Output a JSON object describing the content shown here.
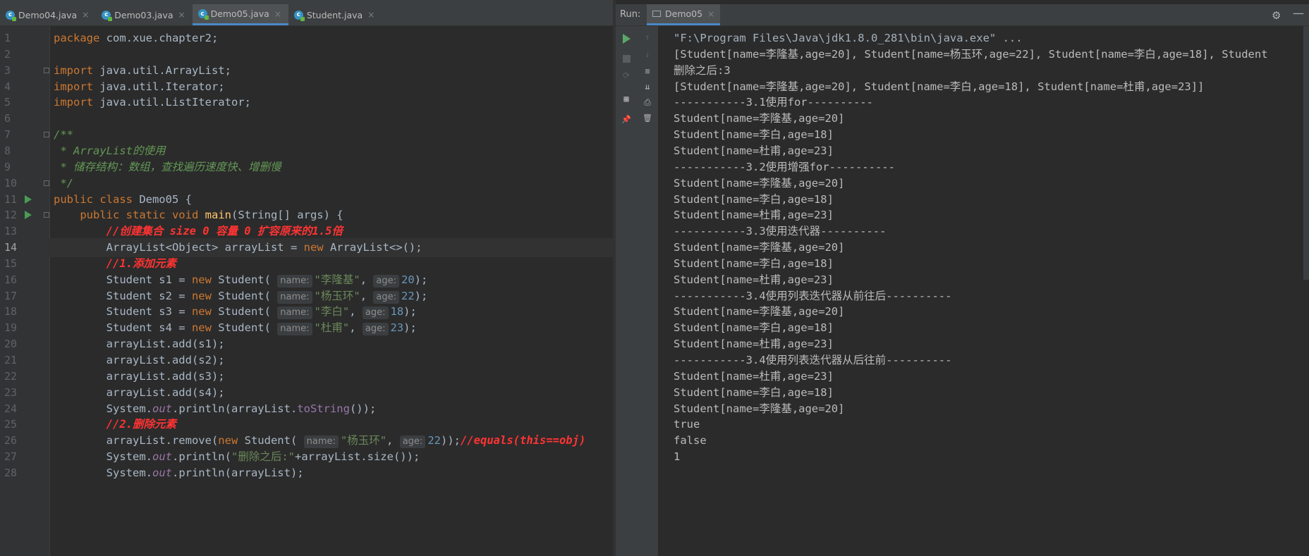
{
  "editor_tabs": [
    {
      "label": "Demo04.java",
      "active": false
    },
    {
      "label": "Demo03.java",
      "active": false
    },
    {
      "label": "Demo05.java",
      "active": true
    },
    {
      "label": "Student.java",
      "active": false
    }
  ],
  "code_lines": [
    {
      "n": "1",
      "html": "<span class=\"kw\">package</span> com.xue.chapter2;"
    },
    {
      "n": "2",
      "html": ""
    },
    {
      "n": "3",
      "html": "<span class=\"kw\">import</span> java.util.ArrayList;"
    },
    {
      "n": "4",
      "html": "<span class=\"kw\">import</span> java.util.Iterator;"
    },
    {
      "n": "5",
      "html": "<span class=\"kw\">import</span> java.util.ListIterator;"
    },
    {
      "n": "6",
      "html": ""
    },
    {
      "n": "7",
      "html": "<span class=\"cm\">/**</span>"
    },
    {
      "n": "8",
      "html": "<span class=\"cm\"> * ArrayList的使用</span>"
    },
    {
      "n": "9",
      "html": "<span class=\"cm\"> * 储存结构：数组，查找遍历速度快、增删慢</span>"
    },
    {
      "n": "10",
      "html": "<span class=\"cm\"> */</span>"
    },
    {
      "n": "11",
      "html": "<span class=\"kw\">public class</span> Demo05 {"
    },
    {
      "n": "12",
      "html": "    <span class=\"kw\">public static void</span> <span class=\"fn\">main</span>(String[] args) {"
    },
    {
      "n": "13",
      "html": "        <span class=\"red\">//创建集合 size 0 容量 0 扩容原来的1.5倍</span>"
    },
    {
      "n": "14",
      "html": "        ArrayList&lt;Object&gt; arrayList = <span class=\"kw\">new</span> ArrayList&lt;&gt;();"
    },
    {
      "n": "15",
      "html": "        <span class=\"red\">//1.添加元素</span>"
    },
    {
      "n": "16",
      "html": "        Student s1 = <span class=\"kw\">new</span> Student( <span class=\"hint\">name:</span><span class=\"str\">\"李隆基\"</span>, <span class=\"hint\">age:</span><span class=\"num\">20</span>);"
    },
    {
      "n": "17",
      "html": "        Student s2 = <span class=\"kw\">new</span> Student( <span class=\"hint\">name:</span><span class=\"str\">\"杨玉环\"</span>, <span class=\"hint\">age:</span><span class=\"num\">22</span>);"
    },
    {
      "n": "18",
      "html": "        Student s3 = <span class=\"kw\">new</span> Student( <span class=\"hint\">name:</span><span class=\"str\">\"李白\"</span>, <span class=\"hint\">age:</span><span class=\"num\">18</span>);"
    },
    {
      "n": "19",
      "html": "        Student s4 = <span class=\"kw\">new</span> Student( <span class=\"hint\">name:</span><span class=\"str\">\"杜甫\"</span>, <span class=\"hint\">age:</span><span class=\"num\">23</span>);"
    },
    {
      "n": "20",
      "html": "        arrayList.add(s1);"
    },
    {
      "n": "21",
      "html": "        arrayList.add(s2);"
    },
    {
      "n": "22",
      "html": "        arrayList.add(s3);"
    },
    {
      "n": "23",
      "html": "        arrayList.add(s4);"
    },
    {
      "n": "24",
      "html": "        System.<span class=\"static\">out</span>.println(arrayList.<span class=\"method2\">toString</span>());"
    },
    {
      "n": "25",
      "html": "        <span class=\"red\">//2.删除元素</span>"
    },
    {
      "n": "26",
      "html": "        arrayList.remove(<span class=\"kw\">new</span> Student( <span class=\"hint\">name:</span><span class=\"str\">\"杨玉环\"</span>, <span class=\"hint\">age:</span><span class=\"num\">22</span>));<span class=\"red\">//equals(this==obj)</span>"
    },
    {
      "n": "27",
      "html": "        System.<span class=\"static\">out</span>.println(<span class=\"str\">\"删除之后:\"</span>+arrayList.size());"
    },
    {
      "n": "28",
      "html": "        System.<span class=\"static\">out</span>.println(arrayList);"
    }
  ],
  "current_line": "14",
  "run_panel": {
    "label": "Run:",
    "tab": "Demo05"
  },
  "console_lines": [
    "\"F:\\Program Files\\Java\\jdk1.8.0_281\\bin\\java.exe\" ...",
    "[Student[name=李隆基,age=20], Student[name=杨玉环,age=22], Student[name=李白,age=18], Student",
    "删除之后:3",
    "[Student[name=李隆基,age=20], Student[name=李白,age=18], Student[name=杜甫,age=23]]",
    "-----------3.1使用for----------",
    "Student[name=李隆基,age=20]",
    "Student[name=李白,age=18]",
    "Student[name=杜甫,age=23]",
    "-----------3.2使用增强for----------",
    "Student[name=李隆基,age=20]",
    "Student[name=李白,age=18]",
    "Student[name=杜甫,age=23]",
    "-----------3.3使用迭代器----------",
    "Student[name=李隆基,age=20]",
    "Student[name=李白,age=18]",
    "Student[name=杜甫,age=23]",
    "-----------3.4使用列表迭代器从前往后----------",
    "Student[name=李隆基,age=20]",
    "Student[name=李白,age=18]",
    "Student[name=杜甫,age=23]",
    "-----------3.4使用列表迭代器从后往前----------",
    "Student[name=杜甫,age=23]",
    "Student[name=李白,age=18]",
    "Student[name=李隆基,age=20]",
    "true",
    "false",
    "1"
  ],
  "icons": {
    "tab_close": "×",
    "gear": "⚙",
    "minimize": "—",
    "scroll_up": "↑",
    "scroll_down": "↓",
    "soft_wrap": "≡",
    "scroll_end": "⇊",
    "print": "⎙",
    "trash": "🗑",
    "pin": "📌",
    "layout": "▦",
    "rerun": "⟳"
  }
}
